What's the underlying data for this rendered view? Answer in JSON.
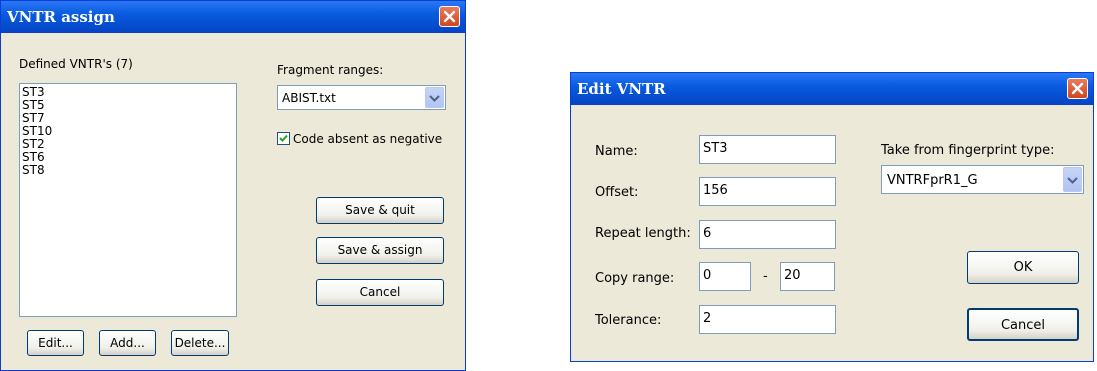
{
  "vntr_assign": {
    "title": "VNTR assign",
    "defined_label": "Defined VNTR's (7)",
    "vntr_list": [
      "ST3",
      "ST5",
      "ST7",
      "ST10",
      "ST2",
      "ST6",
      "ST8"
    ],
    "fragment_ranges_label": "Fragment ranges:",
    "fragment_ranges_value": "ABIST.txt",
    "code_absent_label": "Code absent as negative",
    "code_absent_checked": true,
    "save_quit": "Save & quit",
    "save_assign": "Save & assign",
    "cancel": "Cancel",
    "edit": "Edit...",
    "add": "Add...",
    "delete": "Delete..."
  },
  "edit_vntr": {
    "title": "Edit VNTR",
    "name_label": "Name:",
    "name_value": "ST3",
    "offset_label": "Offset:",
    "offset_value": "156",
    "repeat_label": "Repeat length:",
    "repeat_value": "6",
    "copy_label": "Copy range:",
    "copy_min": "0",
    "copy_sep": "-",
    "copy_max": "20",
    "tolerance_label": "Tolerance:",
    "tolerance_value": "2",
    "fingerprint_label": "Take from fingerprint type:",
    "fingerprint_value": "VNTRFprR1_G",
    "ok": "OK",
    "cancel": "Cancel"
  },
  "colors": {
    "titlebar": "#0a5be0",
    "dialog_bg": "#ece9d8",
    "close_red": "#d2461f"
  }
}
